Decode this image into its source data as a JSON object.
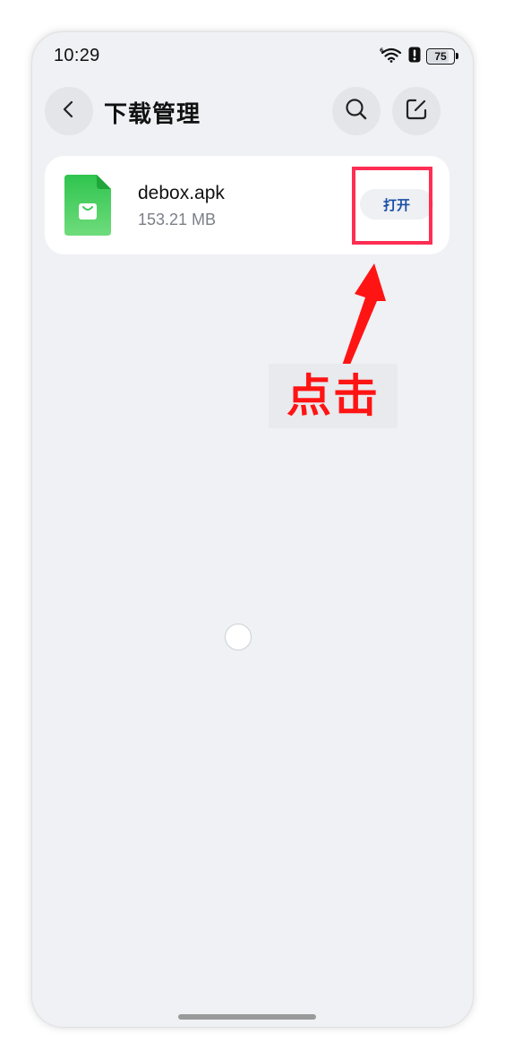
{
  "status_bar": {
    "time": "10:29",
    "battery_level": "75",
    "icons": [
      "wifi-6-icon",
      "alert-icon",
      "battery-icon"
    ]
  },
  "header": {
    "title": "下载管理",
    "buttons": [
      "back-icon",
      "search-icon",
      "edit-icon"
    ]
  },
  "download_item": {
    "file_name": "debox.apk",
    "file_size": "153.21 MB",
    "action_label": "打开",
    "icon": "apk-file-icon"
  },
  "annotation": {
    "text": "点击",
    "color": "#ff1414"
  },
  "colors": {
    "background": "#eff1f4",
    "card": "#ffffff",
    "highlight": "#ff2e52",
    "file_icon_green": "#3cc75a",
    "action_text": "#1a4ea8"
  }
}
